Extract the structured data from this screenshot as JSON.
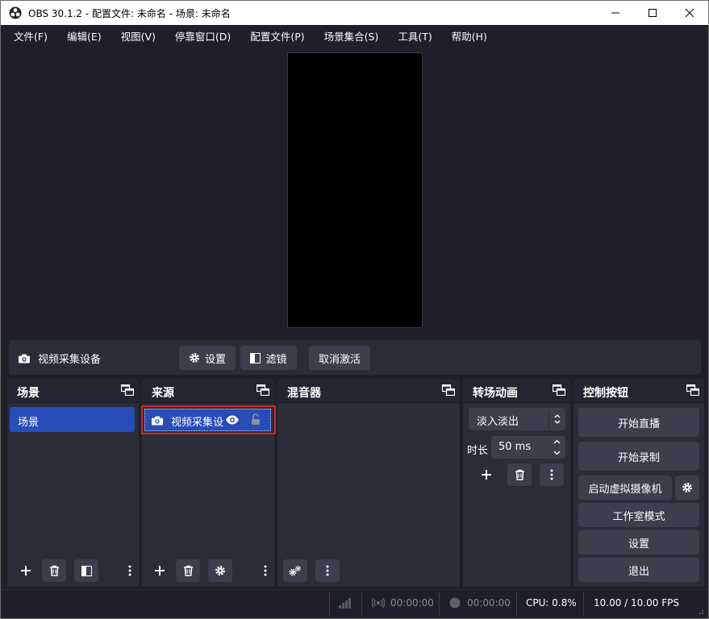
{
  "window": {
    "title": "OBS 30.1.2 - 配置文件: 未命名 - 场景: 未命名",
    "minimize_icon": "minimize-icon",
    "maximize_icon": "maximize-icon",
    "close_icon": "close-icon"
  },
  "menu": [
    "文件(F)",
    "编辑(E)",
    "视图(V)",
    "停靠窗口(D)",
    "配置文件(P)",
    "场景集合(S)",
    "工具(T)",
    "帮助(H)"
  ],
  "source_toolbar": {
    "current_source": "视频采集设备",
    "settings_label": "设置",
    "filters_label": "滤镜",
    "deactivate_label": "取消激活"
  },
  "docks": {
    "scenes": {
      "title": "场景",
      "items": [
        "场景"
      ]
    },
    "sources": {
      "title": "来源",
      "items": [
        {
          "label": "视频采集设"
        }
      ]
    },
    "mixer": {
      "title": "混音器"
    },
    "transitions": {
      "title": "转场动画",
      "selected": "淡入淡出",
      "duration_label": "时长",
      "duration_value": "50 ms"
    },
    "controls": {
      "title": "控制按钮",
      "start_streaming": "开始直播",
      "start_recording": "开始录制",
      "virtual_camera": "启动虚拟摄像机",
      "studio_mode": "工作室模式",
      "settings": "设置",
      "exit": "退出"
    }
  },
  "status": {
    "stream_time": "00:00:00",
    "record_time": "00:00:00",
    "cpu": "CPU: 0.8%",
    "fps": "10.00 / 10.00 FPS"
  },
  "colors": {
    "background": "#1e1f29",
    "dock": "#2a2c38",
    "button": "#3b3e4c",
    "selected": "#284cb8",
    "highlight_border": "#e0201b"
  }
}
